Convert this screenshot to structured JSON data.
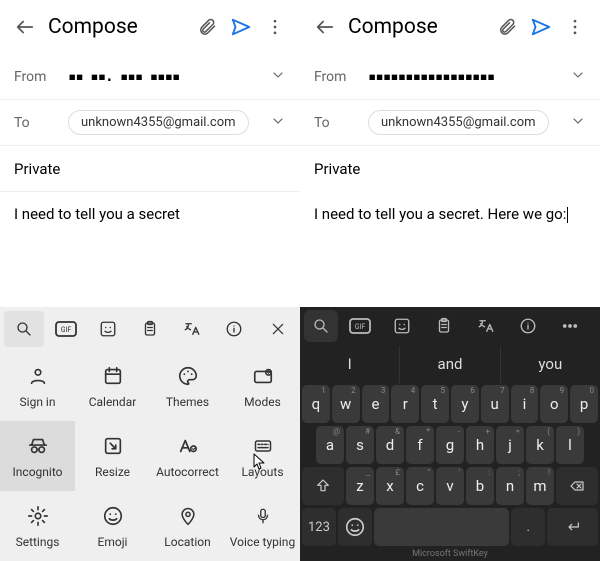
{
  "left": {
    "header": {
      "title": "Compose"
    },
    "from": {
      "label": "From",
      "value": "▪▪  ▪▪.  ▪▪▪  ▪▪▪▪"
    },
    "to": {
      "label": "To",
      "chip": "unknown4355@gmail.com"
    },
    "subject": "Private",
    "body": "I need to tell you a secret",
    "keyboard": {
      "strip_icons": [
        "search",
        "gif",
        "sticker",
        "clipboard",
        "translate",
        "info",
        "close"
      ],
      "cells": [
        {
          "icon": "signin",
          "label": "Sign in",
          "active": false
        },
        {
          "icon": "calendar",
          "label": "Calendar",
          "active": false
        },
        {
          "icon": "themes",
          "label": "Themes",
          "active": false
        },
        {
          "icon": "modes",
          "label": "Modes",
          "active": false
        },
        {
          "icon": "incognito",
          "label": "Incognito",
          "active": true
        },
        {
          "icon": "resize",
          "label": "Resize",
          "active": false
        },
        {
          "icon": "autocorrect",
          "label": "Autocorrect",
          "active": false
        },
        {
          "icon": "layouts",
          "label": "Layouts",
          "active": false
        },
        {
          "icon": "settings",
          "label": "Settings",
          "active": false
        },
        {
          "icon": "emoji",
          "label": "Emoji",
          "active": false
        },
        {
          "icon": "location",
          "label": "Location",
          "active": false
        },
        {
          "icon": "voice",
          "label": "Voice typing",
          "active": false
        }
      ]
    }
  },
  "right": {
    "header": {
      "title": "Compose"
    },
    "from": {
      "label": "From",
      "value": "▪▪▪▪▪▪▪▪▪▪▪▪▪▪▪▪▪"
    },
    "to": {
      "label": "To",
      "chip": "unknown4355@gmail.com"
    },
    "subject": "Private",
    "body": "I need to tell you a secret. Here we go:",
    "keyboard": {
      "strip_icons": [
        "search",
        "gif",
        "sticker",
        "clipboard",
        "translate",
        "info",
        "more"
      ],
      "suggestions": [
        "I",
        "and",
        "you"
      ],
      "rows": [
        [
          "q",
          "w",
          "e",
          "r",
          "t",
          "y",
          "u",
          "i",
          "o",
          "p"
        ],
        [
          "a",
          "s",
          "d",
          "f",
          "g",
          "h",
          "j",
          "k",
          "l"
        ],
        [
          "shift",
          "z",
          "x",
          "c",
          "v",
          "b",
          "n",
          "m",
          "bksp"
        ],
        [
          "123",
          "emoji",
          "space",
          "dot",
          "enter"
        ]
      ],
      "credit": "Microsoft SwiftKey"
    }
  }
}
